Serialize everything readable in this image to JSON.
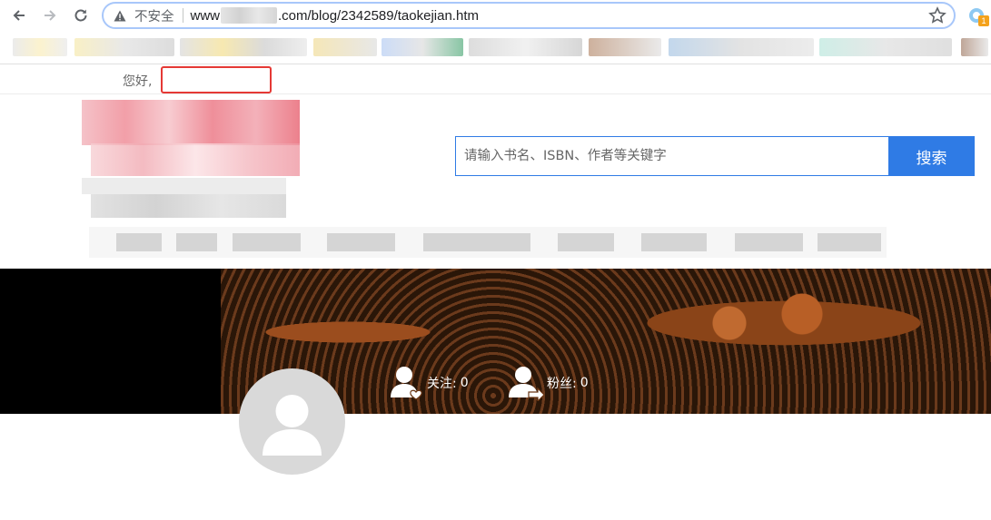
{
  "browser": {
    "security_label": "不安全",
    "url_prefix": "www",
    "url_suffix": ".com/blog/2342589/taokejian.htm",
    "extension_badge": "1"
  },
  "site": {
    "greeting": "您好,",
    "search": {
      "placeholder": "请输入书名、ISBN、作者等关键字",
      "button_label": "搜索"
    },
    "profile": {
      "follow_label": "关注:",
      "follow_count": "0",
      "fans_label": "粉丝:",
      "fans_count": "0"
    }
  },
  "colors": {
    "accent": "#2f7be5",
    "highlight_box": "#e53935",
    "avatar_bg": "#d9d9d9"
  },
  "icons": [
    "back-icon",
    "forward-icon",
    "reload-icon",
    "warning-icon",
    "star-icon",
    "extension-icon",
    "follow-icon",
    "fans-icon",
    "avatar-icon"
  ]
}
